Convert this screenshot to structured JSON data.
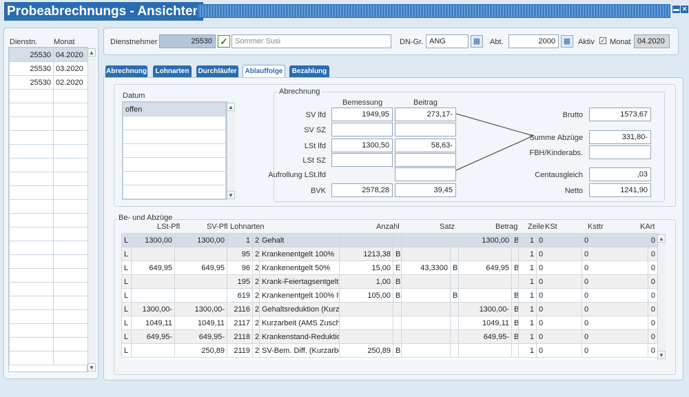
{
  "window": {
    "title": "Probeabrechnungs - Ansichten",
    "min_icon": "minimize-icon",
    "close_icon": "close-icon"
  },
  "left_list": {
    "headers": [
      "Dienstn.",
      "Monat"
    ],
    "rows": [
      [
        "25530",
        "04.2020"
      ],
      [
        "25530",
        "03.2020"
      ],
      [
        "25530",
        "02.2020"
      ]
    ]
  },
  "header": {
    "dienstnehmer_label": "Dienstnehmer",
    "dienstnehmer_nr": "25530",
    "dienstnehmer_name": "Sommer Susi",
    "dngr_label": "DN-Gr.",
    "dngr_value": "ANG",
    "abt_label": "Abt.",
    "abt_value": "2000",
    "aktiv_label": "Aktiv",
    "aktiv_checked": true,
    "monat_label": "Monat",
    "monat_value": "04.2020"
  },
  "tabs": [
    "Abrechnung",
    "Lohnarten",
    "Durchläufer",
    "Ablauffolge",
    "Bezahlung"
  ],
  "active_tab": "Ablauffolge",
  "datum": {
    "label": "Datum",
    "items": [
      "offen"
    ]
  },
  "abrechnung": {
    "label": "Abrechnung",
    "col_bemessung": "Bemessung",
    "col_beitrag": "Beitrag",
    "rows": [
      {
        "label": "SV lfd",
        "bemessung": "1949,95",
        "beitrag": "273,17-"
      },
      {
        "label": "SV SZ",
        "bemessung": "",
        "beitrag": ""
      },
      {
        "label": "LSt lfd",
        "bemessung": "1300,50",
        "beitrag": "58,63-"
      },
      {
        "label": "LSt SZ",
        "bemessung": "",
        "beitrag": ""
      },
      {
        "label": "Aufrollung LSt.lfd",
        "bemessung": null,
        "beitrag": ""
      },
      {
        "label": "BVK",
        "bemessung": "2578,28",
        "beitrag": "39,45"
      }
    ],
    "right": [
      {
        "label": "Brutto",
        "value": "1573,67"
      },
      {
        "label": "Summe Abzüge",
        "value": "331,80-"
      },
      {
        "label": "FBH/Kinderabs.",
        "value": ""
      },
      {
        "label": "Centausgleich",
        "value": ",03"
      },
      {
        "label": "Netto",
        "value": "1241,90"
      }
    ]
  },
  "bezuege": {
    "label": "Be- und Abzüge",
    "headers": [
      "LSt-Pfl",
      "SV-Pfl",
      "Lohnarten",
      "Anzahl",
      "Satz",
      "Betrag",
      "Zeile",
      "KSt",
      "Ksttr",
      "KArt"
    ],
    "rows": [
      [
        "L",
        "1300,00",
        "1300,00",
        "1",
        "2",
        "Gehalt",
        "",
        "",
        "",
        "",
        "1300,00",
        "B",
        "1",
        "0",
        "0",
        "0"
      ],
      [
        "L",
        "",
        "",
        "95",
        "2",
        "Krankenentgelt 100%",
        "1213,38",
        "B",
        "",
        "",
        "",
        "",
        "1",
        "0",
        "0",
        "0"
      ],
      [
        "L",
        "649,95",
        "649,95",
        "96",
        "2",
        "Krankenentgelt 50%",
        "15,00",
        "E",
        "43,3300",
        "B",
        "649,95",
        "B",
        "1",
        "0",
        "0",
        "0"
      ],
      [
        "L",
        "",
        "",
        "195",
        "2",
        "Krank-Feiertagsentgelt",
        "1,00",
        "B",
        "",
        "",
        "",
        "",
        "1",
        "0",
        "0",
        "0"
      ],
      [
        "L",
        "",
        "",
        "619",
        "2",
        "Krankenentgelt 100% It",
        "105,00",
        "B",
        "",
        "B",
        "",
        "B",
        "1",
        "0",
        "0",
        "0"
      ],
      [
        "L",
        "1300,00-",
        "1300,00-",
        "2116",
        "2",
        "Gehaltsreduktion (Kurzarbeit)",
        "",
        "",
        "",
        "",
        "1300,00-",
        "B",
        "1",
        "0",
        "0",
        "0"
      ],
      [
        "L",
        "1049,11",
        "1049,11",
        "2117",
        "2",
        "Kurzarbeit (AMS Zuschuss)",
        "",
        "",
        "",
        "",
        "1049,11",
        "B",
        "1",
        "0",
        "0",
        "0"
      ],
      [
        "L",
        "649,95-",
        "649,95-",
        "2118",
        "2",
        "Krankenstand-Reduktion",
        "",
        "",
        "",
        "",
        "649,95-",
        "B",
        "1",
        "0",
        "0",
        "0"
      ],
      [
        "L",
        "",
        "250,89",
        "2119",
        "2",
        "SV-Bem. Diff. (Kurzarbeit)",
        "250,89",
        "B",
        "",
        "",
        "",
        "",
        "1",
        "0",
        "0",
        "0"
      ]
    ]
  },
  "colors": {
    "accent": "#2a6cb0",
    "panel": "#f2f6fa",
    "bg": "#dde9f3"
  }
}
